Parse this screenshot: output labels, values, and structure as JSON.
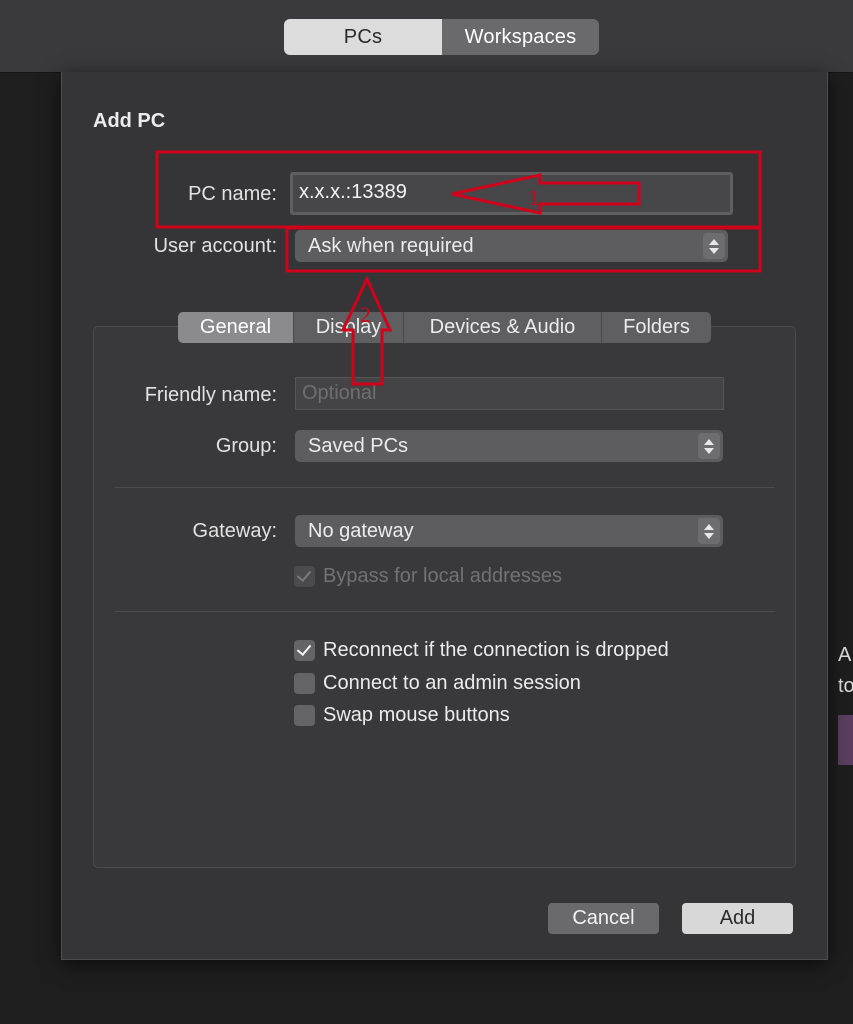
{
  "toolbar": {
    "tabs": [
      {
        "label": "PCs",
        "active": true
      },
      {
        "label": "Workspaces",
        "active": false
      }
    ]
  },
  "background": {
    "text_line_1": "A",
    "text_line_2": "to"
  },
  "sheet": {
    "title": "Add PC",
    "pc_name": {
      "label": "PC name:",
      "value": "x.x.x.:13389"
    },
    "user_account": {
      "label": "User account:",
      "value": "Ask when required"
    },
    "tabs": [
      {
        "label": "General",
        "active": true
      },
      {
        "label": "Display",
        "active": false
      },
      {
        "label": "Devices & Audio",
        "active": false
      },
      {
        "label": "Folders",
        "active": false
      }
    ],
    "friendly_name": {
      "label": "Friendly name:",
      "placeholder": "Optional"
    },
    "group": {
      "label": "Group:",
      "value": "Saved PCs"
    },
    "gateway": {
      "label": "Gateway:",
      "value": "No gateway"
    },
    "bypass": {
      "label": "Bypass for local addresses",
      "checked": true,
      "enabled": false
    },
    "options": [
      {
        "label": "Reconnect if the connection is dropped",
        "checked": true
      },
      {
        "label": "Connect to an admin session",
        "checked": false
      },
      {
        "label": "Swap mouse buttons",
        "checked": false
      }
    ],
    "cancel_label": "Cancel",
    "add_label": "Add"
  },
  "annotations": {
    "marker_1": "1",
    "marker_2": "2",
    "color": "#d0021b"
  },
  "colors": {
    "toolbar_bg": "#3a393b",
    "sheet_bg": "#353436",
    "accent_red": "#d0021b"
  }
}
